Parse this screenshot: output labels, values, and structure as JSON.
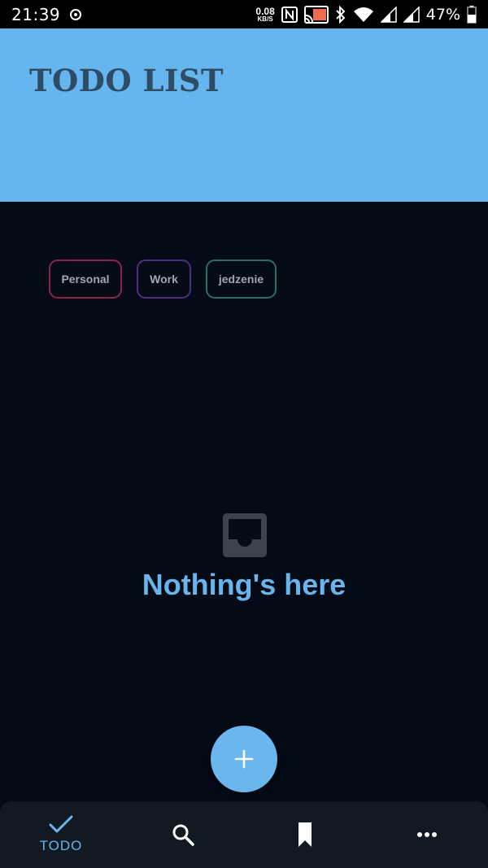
{
  "status_bar": {
    "time": "21:39",
    "net_speed_value": "0.08",
    "net_speed_unit": "KB/S",
    "battery_percent": "47%"
  },
  "header": {
    "title": "TODO LIST",
    "background_color": "#65b6ef"
  },
  "categories": [
    {
      "label": "Personal",
      "border_color": "#8c2547"
    },
    {
      "label": "Work",
      "border_color": "#4b2e7e"
    },
    {
      "label": "jedzenie",
      "border_color": "#2d6e63"
    }
  ],
  "empty_state": {
    "icon": "inbox-icon",
    "message": "Nothing's here"
  },
  "fab": {
    "icon": "plus-icon"
  },
  "bottom_nav": {
    "items": [
      {
        "icon": "check-icon",
        "label": "TODO",
        "active": true
      },
      {
        "icon": "search-icon",
        "label": ""
      },
      {
        "icon": "bookmark-icon",
        "label": ""
      },
      {
        "icon": "more-horizontal-icon",
        "label": ""
      }
    ],
    "accent_color": "#69b5eb"
  }
}
